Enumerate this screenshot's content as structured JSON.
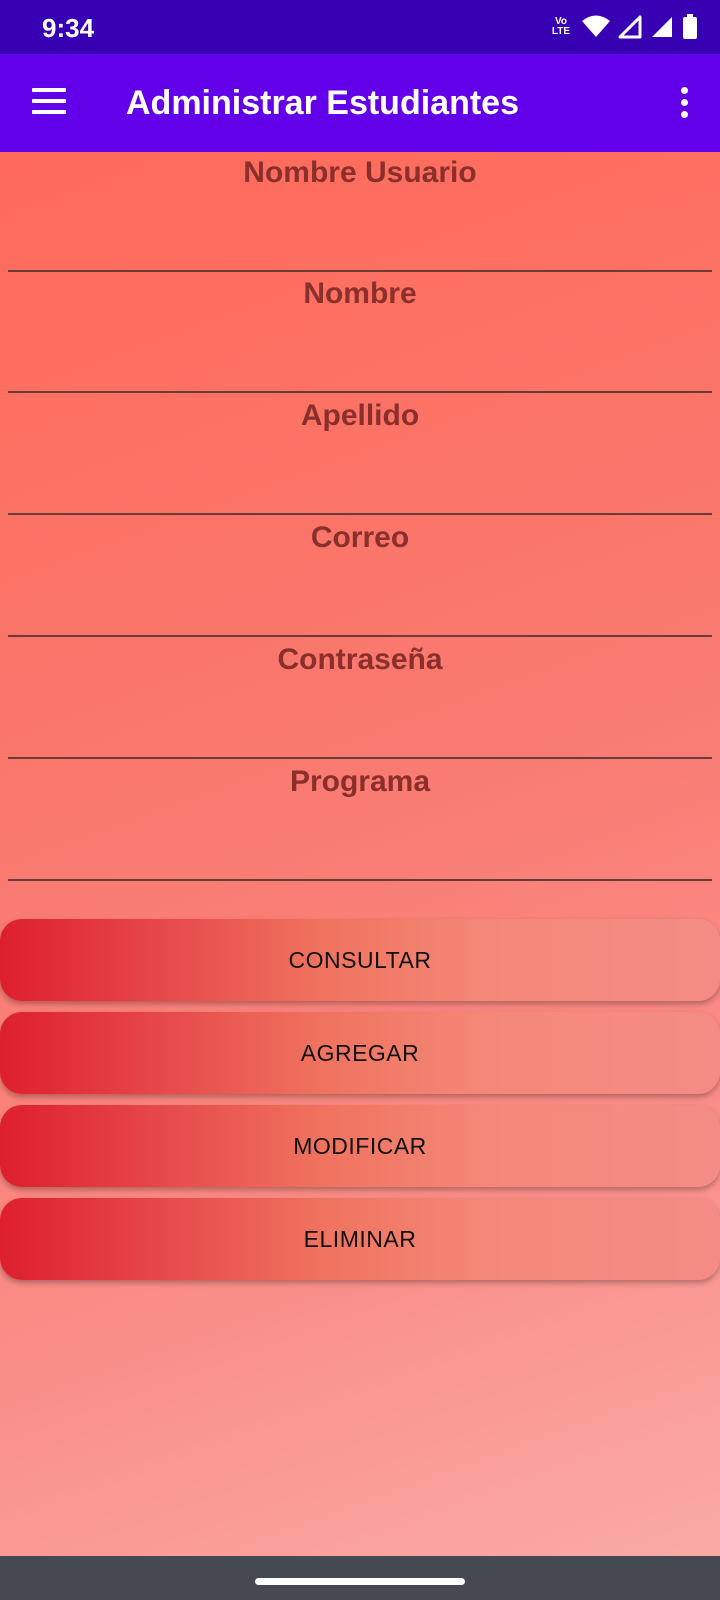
{
  "status_bar": {
    "time": "9:34",
    "volte_line1": "Vo",
    "volte_line2": "LTE",
    "icons": [
      "volte-icon",
      "wifi-icon",
      "signal-icon",
      "signal-icon",
      "battery-icon"
    ]
  },
  "app_bar": {
    "title": "Administrar Estudiantes",
    "menu_icon": "menu-icon",
    "overflow_icon": "overflow-menu-icon"
  },
  "form": {
    "fields": [
      {
        "label": "Nombre Usuario",
        "value": ""
      },
      {
        "label": "Nombre",
        "value": ""
      },
      {
        "label": "Apellido",
        "value": ""
      },
      {
        "label": "Correo",
        "value": ""
      },
      {
        "label": "Contraseña",
        "value": ""
      },
      {
        "label": "Programa",
        "value": ""
      }
    ]
  },
  "buttons": {
    "consultar": "CONSULTAR",
    "agregar": "AGREGAR",
    "modificar": "MODIFICAR",
    "eliminar": "ELIMINAR"
  },
  "colors": {
    "status_bar": "#3700b3",
    "app_bar": "#6200ea",
    "label_text": "#8a2f2c",
    "button_gradient_start": "#de1f2d",
    "button_gradient_end": "#f48c86",
    "nav_bar": "#454a52"
  }
}
